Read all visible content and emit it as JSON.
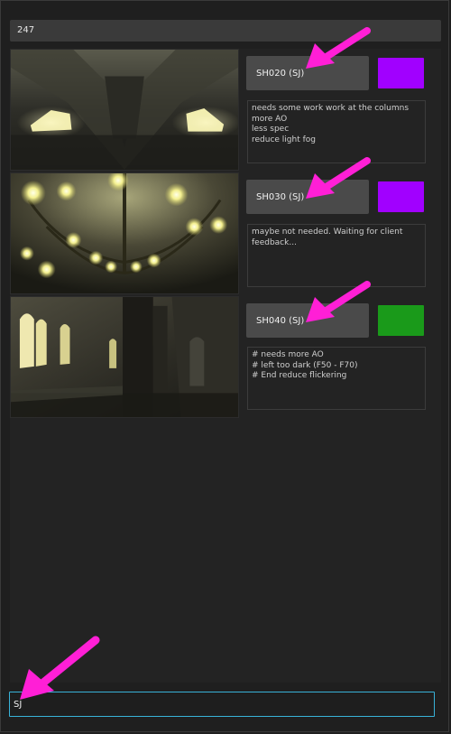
{
  "count": "247",
  "shots": [
    {
      "label": "SH020 (SJ)",
      "color": "#a100ff",
      "notes": [
        "needs some work work at the columns",
        "more AO",
        "less spec",
        "reduce light fog"
      ]
    },
    {
      "label": "SH030 (SJ)",
      "color": "#a100ff",
      "notes": [
        "maybe not needed. Waiting for client",
        "feedback..."
      ]
    },
    {
      "label": "SH040 (SJ)",
      "color": "#1a9a1a",
      "notes": [
        "# needs more AO",
        "# left too dark (F50 - F70)",
        "# End reduce flickering"
      ]
    }
  ],
  "search": {
    "value": "SJ"
  },
  "annotation_color": "#ff1fd6"
}
